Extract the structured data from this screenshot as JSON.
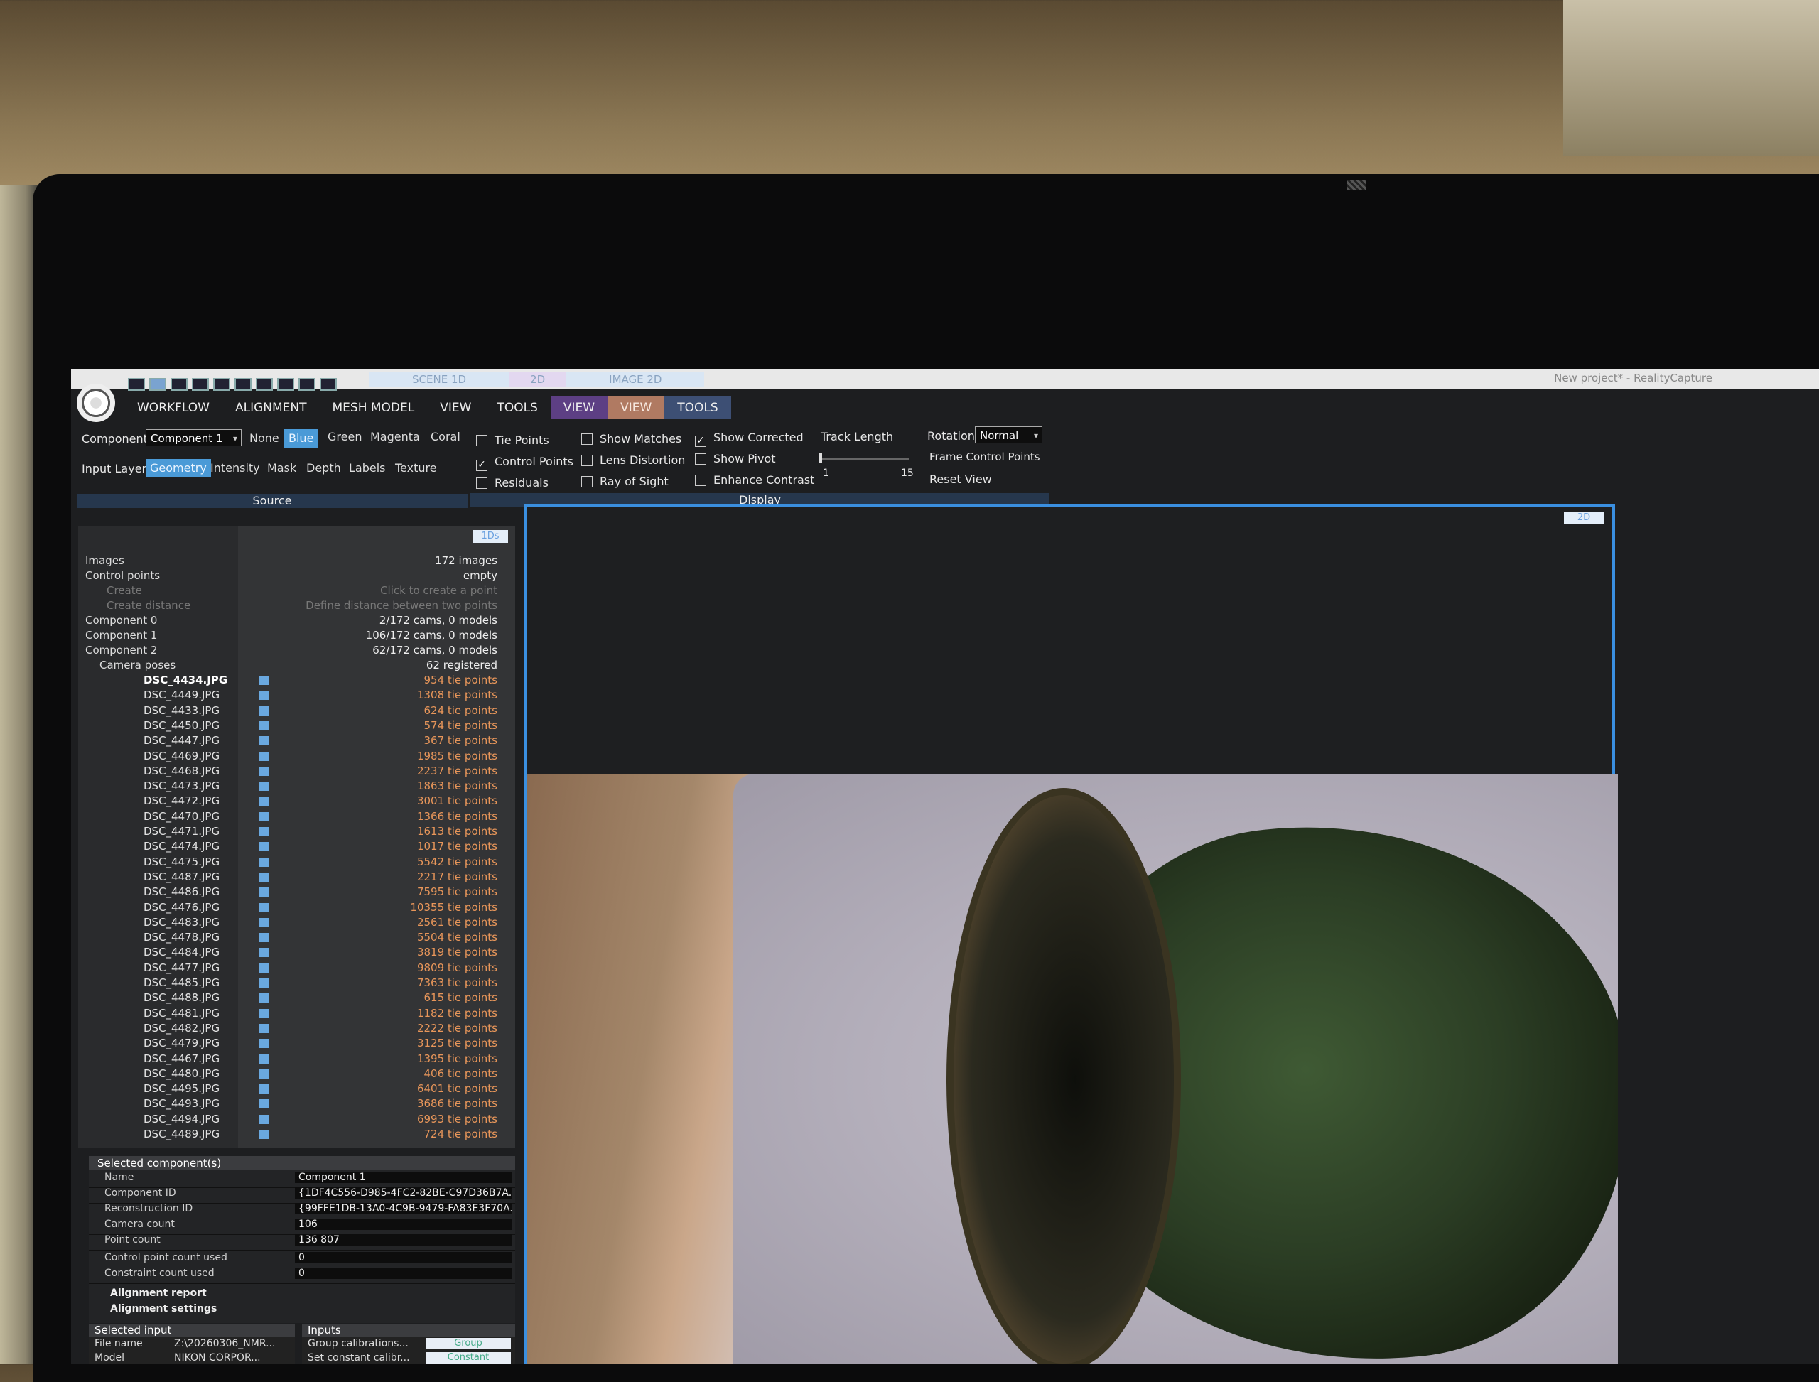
{
  "window": {
    "doc_tabs": [
      "SCENE 1D",
      "2D",
      "IMAGE 2D"
    ],
    "app_title": "New project* - RealityCapture"
  },
  "menu": {
    "items": [
      "WORKFLOW",
      "ALIGNMENT",
      "MESH MODEL",
      "VIEW",
      "TOOLS"
    ],
    "context_items": [
      "VIEW",
      "VIEW",
      "TOOLS"
    ]
  },
  "ribbon": {
    "component_label": "Component",
    "component_value": "Component 1",
    "color_options": [
      "None",
      "Blue",
      "Green",
      "Magenta",
      "Coral"
    ],
    "selected_color": "Blue",
    "input_layer_label": "Input Layer",
    "layer_options": [
      "Geometry",
      "Intensity",
      "Mask",
      "Depth",
      "Labels",
      "Texture"
    ],
    "selected_layer": "Geometry",
    "source_label": "Source",
    "checkboxes": [
      {
        "label": "Tie Points",
        "checked": false
      },
      {
        "label": "Control Points",
        "checked": true
      },
      {
        "label": "Residuals",
        "checked": false
      },
      {
        "label": "Show Matches",
        "checked": false
      },
      {
        "label": "Lens Distortion",
        "checked": false
      },
      {
        "label": "Ray of Sight",
        "checked": false
      },
      {
        "label": "Show Corrected",
        "checked": true
      },
      {
        "label": "Show Pivot",
        "checked": false
      },
      {
        "label": "Enhance Contrast",
        "checked": false
      }
    ],
    "track_length_label": "Track Length",
    "track_min": "1",
    "track_max": "15",
    "rotation_label": "Rotation",
    "rotation_value": "Normal",
    "frame_control_points": "Frame Control Points",
    "reset_view": "Reset View",
    "display_label": "Display"
  },
  "tree": {
    "badge": "1Ds",
    "items": [
      "Images",
      "Control points",
      "Create",
      "Create distance",
      "Component 0",
      "Component 1",
      "Component 2",
      "Camera poses"
    ],
    "info": [
      "172 images",
      "empty",
      "Click to create a point",
      "Define distance between two points",
      "2/172 cams, 0 models",
      "106/172 cams, 0 models",
      "62/172 cams, 0 models",
      "62 registered"
    ],
    "cameras": [
      {
        "name": "DSC_4434.JPG",
        "tie": "954 tie points"
      },
      {
        "name": "DSC_4449.JPG",
        "tie": "1308 tie points"
      },
      {
        "name": "DSC_4433.JPG",
        "tie": "624 tie points"
      },
      {
        "name": "DSC_4450.JPG",
        "tie": "574 tie points"
      },
      {
        "name": "DSC_4447.JPG",
        "tie": "367 tie points"
      },
      {
        "name": "DSC_4469.JPG",
        "tie": "1985 tie points"
      },
      {
        "name": "DSC_4468.JPG",
        "tie": "2237 tie points"
      },
      {
        "name": "DSC_4473.JPG",
        "tie": "1863 tie points"
      },
      {
        "name": "DSC_4472.JPG",
        "tie": "3001 tie points"
      },
      {
        "name": "DSC_4470.JPG",
        "tie": "1366 tie points"
      },
      {
        "name": "DSC_4471.JPG",
        "tie": "1613 tie points"
      },
      {
        "name": "DSC_4474.JPG",
        "tie": "1017 tie points"
      },
      {
        "name": "DSC_4475.JPG",
        "tie": "5542 tie points"
      },
      {
        "name": "DSC_4487.JPG",
        "tie": "2217 tie points"
      },
      {
        "name": "DSC_4486.JPG",
        "tie": "7595 tie points"
      },
      {
        "name": "DSC_4476.JPG",
        "tie": "10355 tie points"
      },
      {
        "name": "DSC_4483.JPG",
        "tie": "2561 tie points"
      },
      {
        "name": "DSC_4478.JPG",
        "tie": "5504 tie points"
      },
      {
        "name": "DSC_4484.JPG",
        "tie": "3819 tie points"
      },
      {
        "name": "DSC_4477.JPG",
        "tie": "9809 tie points"
      },
      {
        "name": "DSC_4485.JPG",
        "tie": "7363 tie points"
      },
      {
        "name": "DSC_4488.JPG",
        "tie": "615 tie points"
      },
      {
        "name": "DSC_4481.JPG",
        "tie": "1182 tie points"
      },
      {
        "name": "DSC_4482.JPG",
        "tie": "2222 tie points"
      },
      {
        "name": "DSC_4479.JPG",
        "tie": "3125 tie points"
      },
      {
        "name": "DSC_4467.JPG",
        "tie": "1395 tie points"
      },
      {
        "name": "DSC_4480.JPG",
        "tie": "406 tie points"
      },
      {
        "name": "DSC_4495.JPG",
        "tie": "6401 tie points"
      },
      {
        "name": "DSC_4493.JPG",
        "tie": "3686 tie points"
      },
      {
        "name": "DSC_4494.JPG",
        "tie": "6993 tie points"
      },
      {
        "name": "DSC_4489.JPG",
        "tie": "724 tie points"
      }
    ]
  },
  "selected_component": {
    "title": "Selected component(s)",
    "rows": [
      {
        "k": "Name",
        "v": "Component 1"
      },
      {
        "k": "Component ID",
        "v": "{1DF4C556-D985-4FC2-82BE-C97D36B7A..."
      },
      {
        "k": "Reconstruction ID",
        "v": "{99FFE1DB-13A0-4C9B-9479-FA83E3F70A..."
      },
      {
        "k": "Camera count",
        "v": "106"
      },
      {
        "k": "Point count",
        "v": "136 807"
      },
      {
        "k": "Control point count used",
        "v": "0"
      },
      {
        "k": "Constraint count used",
        "v": "0"
      }
    ],
    "alignment_report": "Alignment report",
    "alignment_settings": "Alignment settings"
  },
  "selected_input": {
    "title": "Selected input",
    "rows": [
      {
        "k": "File name",
        "v": "Z:\\20260306_NMR..."
      },
      {
        "k": "Model",
        "v": "NIKON CORPOR..."
      }
    ]
  },
  "inputs": {
    "title": "Inputs",
    "rows": [
      {
        "k": "Group calibrations...",
        "btn": "Group"
      },
      {
        "k": "Set constant calibr...",
        "btn": "Constant"
      }
    ]
  },
  "viewport": {
    "badge": "2D"
  }
}
